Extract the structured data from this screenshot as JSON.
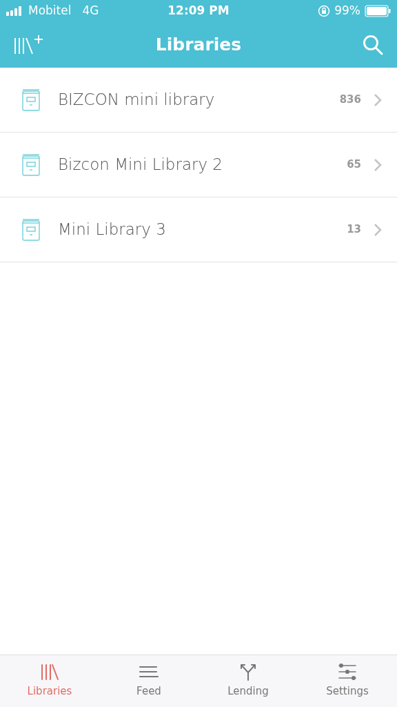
{
  "status_bar": {
    "carrier": "Mobitel",
    "network": "4G",
    "time": "12:09 PM",
    "battery": "99%"
  },
  "header": {
    "title": "Libraries"
  },
  "libraries": [
    {
      "name": "BIZCON mini library",
      "count": "836"
    },
    {
      "name": "Bizcon Mini Library 2",
      "count": "65"
    },
    {
      "name": "Mini Library 3",
      "count": "13"
    }
  ],
  "tabs": [
    {
      "label": "Libraries",
      "kind": "libraries",
      "selected": true
    },
    {
      "label": "Feed",
      "kind": "feed",
      "selected": false
    },
    {
      "label": "Lending",
      "kind": "lending",
      "selected": false
    },
    {
      "label": "Settings",
      "kind": "settings",
      "selected": false
    }
  ]
}
